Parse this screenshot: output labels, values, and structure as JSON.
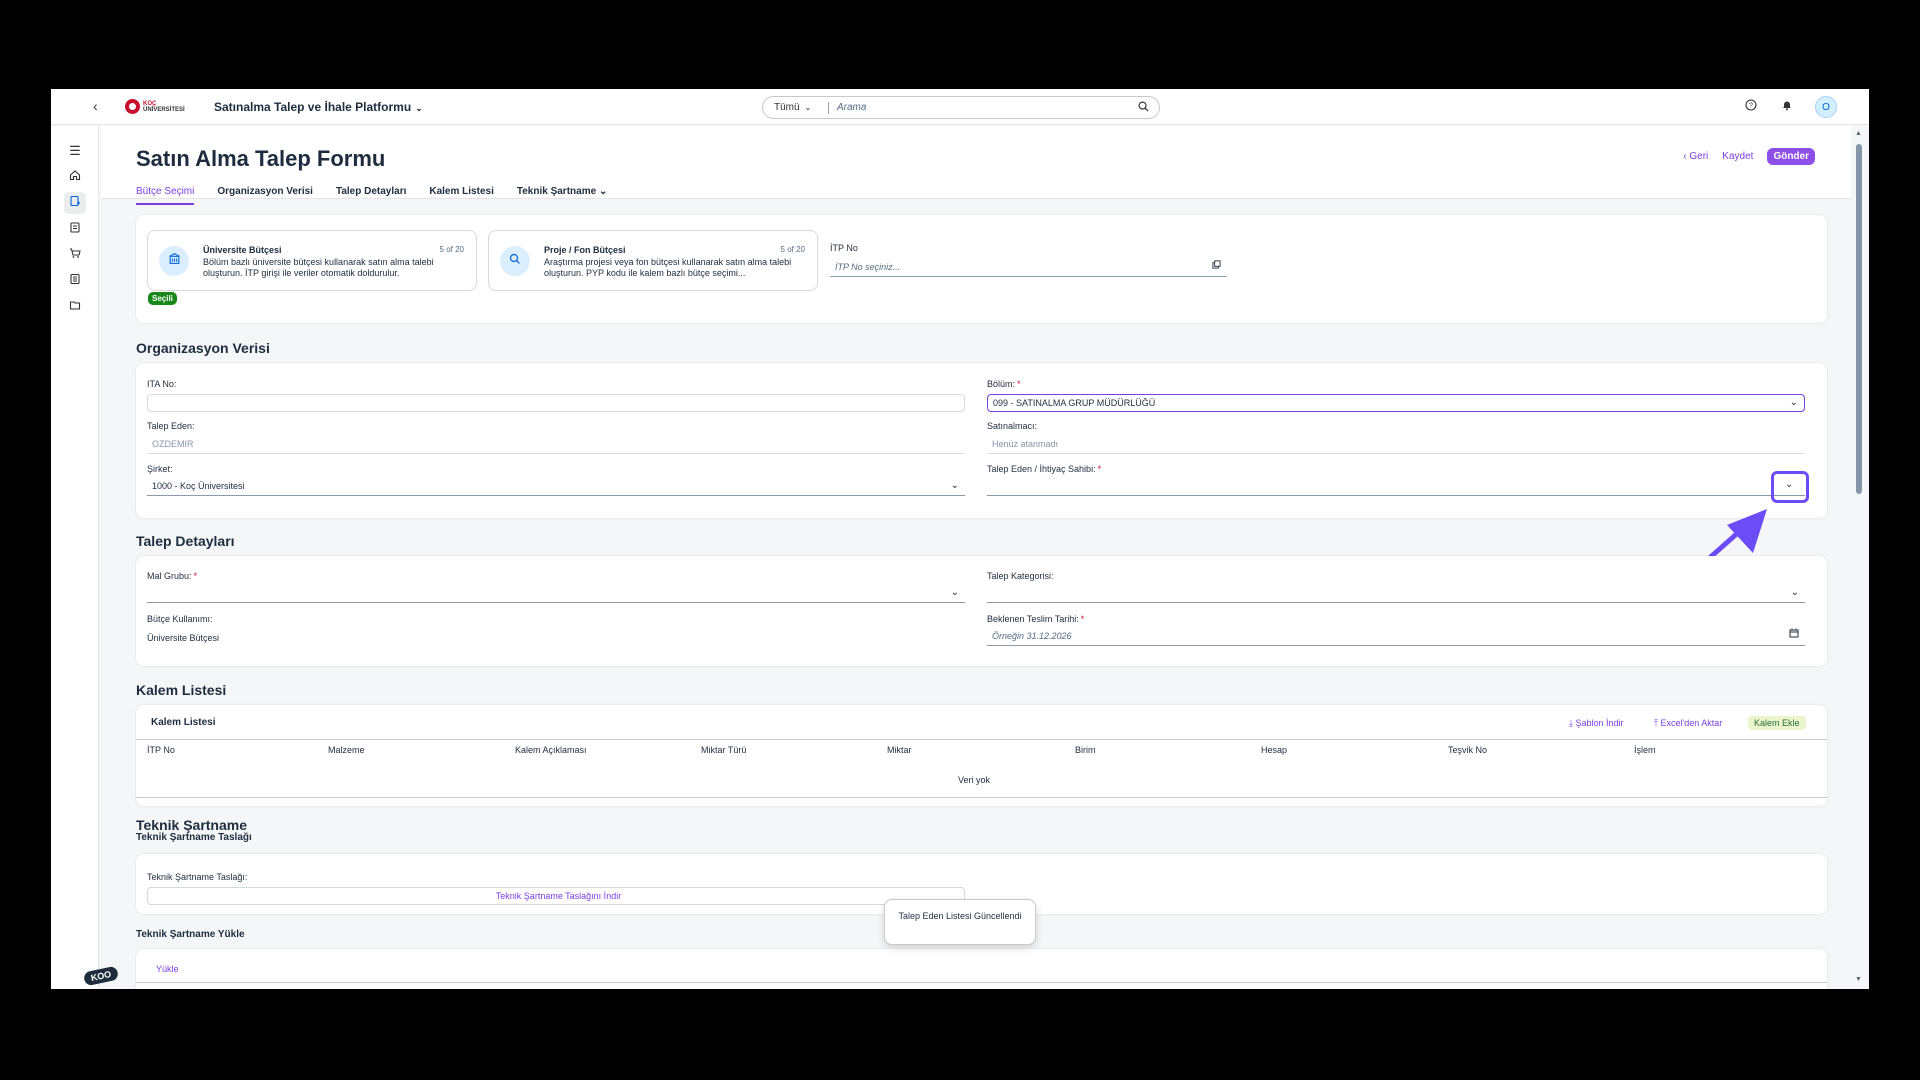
{
  "shell": {
    "logo_line1": "KOÇ",
    "logo_line2": "ÜNİVERSİTESİ",
    "app_title": "Satınalma Talep ve İhale Platformu",
    "search_scope": "Tümü",
    "search_placeholder": "Arama",
    "avatar": "O",
    "icons": [
      "back-icon",
      "help-icon",
      "bell-icon"
    ]
  },
  "sidenav": {
    "icons": [
      "menu-icon",
      "home-icon",
      "request-icon",
      "clipboard-icon",
      "cart-icon",
      "catalog-icon",
      "folder-icon"
    ],
    "badge": "KOO"
  },
  "page": {
    "title": "Satın Alma Talep Formu",
    "tabs": [
      "Bütçe Seçimi",
      "Organizasyon Verisi",
      "Talep Detayları",
      "Kalem Listesi",
      "Teknik Şartname"
    ],
    "actions": {
      "back": "Geri",
      "save": "Kaydet",
      "send": "Gönder"
    }
  },
  "budget": {
    "tiles": [
      {
        "title": "Üniversite Bütçesi",
        "count": "5 of 20",
        "desc": "Bölüm bazlı üniversite bütçesi kullanarak satın alma talebi oluşturun. İTP girişi ile veriler otomatik doldurulur.",
        "icon": "building-icon"
      },
      {
        "title": "Proje / Fon Bütçesi",
        "count": "5 of 20",
        "desc": "Araştırma projesi veya fon bütçesi kullanarak satın alma talebi oluşturun. PYP kodu ile kalem bazlı bütçe seçimi...",
        "icon": "search-icon"
      }
    ],
    "selected_badge": "Seçili",
    "itp_label": "İTP No",
    "itp_placeholder": "İTP No seçiniz..."
  },
  "org": {
    "title": "Organizasyon Verisi",
    "ita_label": "ITA No:",
    "ita_value": "",
    "bolum_label": "Bölüm:",
    "bolum_value": "099 - SATINALMA GRUP MÜDÜRLÜĞÜ",
    "talep_eden_label": "Talep Eden:",
    "talep_eden_value": "OZDEMIR",
    "satinalmaci_label": "Satınalmacı:",
    "satinalmaci_value": "Henüz atanmadı",
    "sirket_label": "Şirket:",
    "sirket_value": "1000 - Koç Üniversitesi",
    "ihtiyac_label": "Talep Eden / İhtiyaç Sahibi:",
    "ihtiyac_value": ""
  },
  "details": {
    "title": "Talep Detayları",
    "mal_label": "Mal Grubu:",
    "kategori_label": "Talep Kategorisi:",
    "butce_label": "Bütçe Kullanımı:",
    "butce_value": "Üniversite Bütçesi",
    "teslim_label": "Beklenen Teslim Tarihi:",
    "teslim_placeholder": "Örneğin 31.12.2026"
  },
  "items": {
    "title": "Kalem Listesi",
    "table_title": "Kalem Listesi",
    "buttons": {
      "template": "Şablon İndir",
      "excel": "Excel'den Aktar",
      "add": "Kalem Ekle"
    },
    "columns": [
      "İTP No",
      "Malzeme",
      "Kalem Açıklaması",
      "Miktar Türü",
      "Miktar",
      "Birim",
      "Hesap",
      "Teşvik No",
      "İşlem"
    ],
    "empty": "Veri yok"
  },
  "spec": {
    "title": "Teknik Şartname",
    "draft_title": "Teknik Şartname Taslağı",
    "draft_label": "Teknik Şartname Taslağı:",
    "draft_button": "Teknik Şartname Taslağını İndir",
    "upload_title": "Teknik Şartname Yükle",
    "upload_tab": "Yükle"
  },
  "toast": "Talep Eden Listesi Güncellendi",
  "colors": {
    "accent": "#7b3fe4",
    "highlight": "#6b4cf6",
    "success": "#188918"
  }
}
